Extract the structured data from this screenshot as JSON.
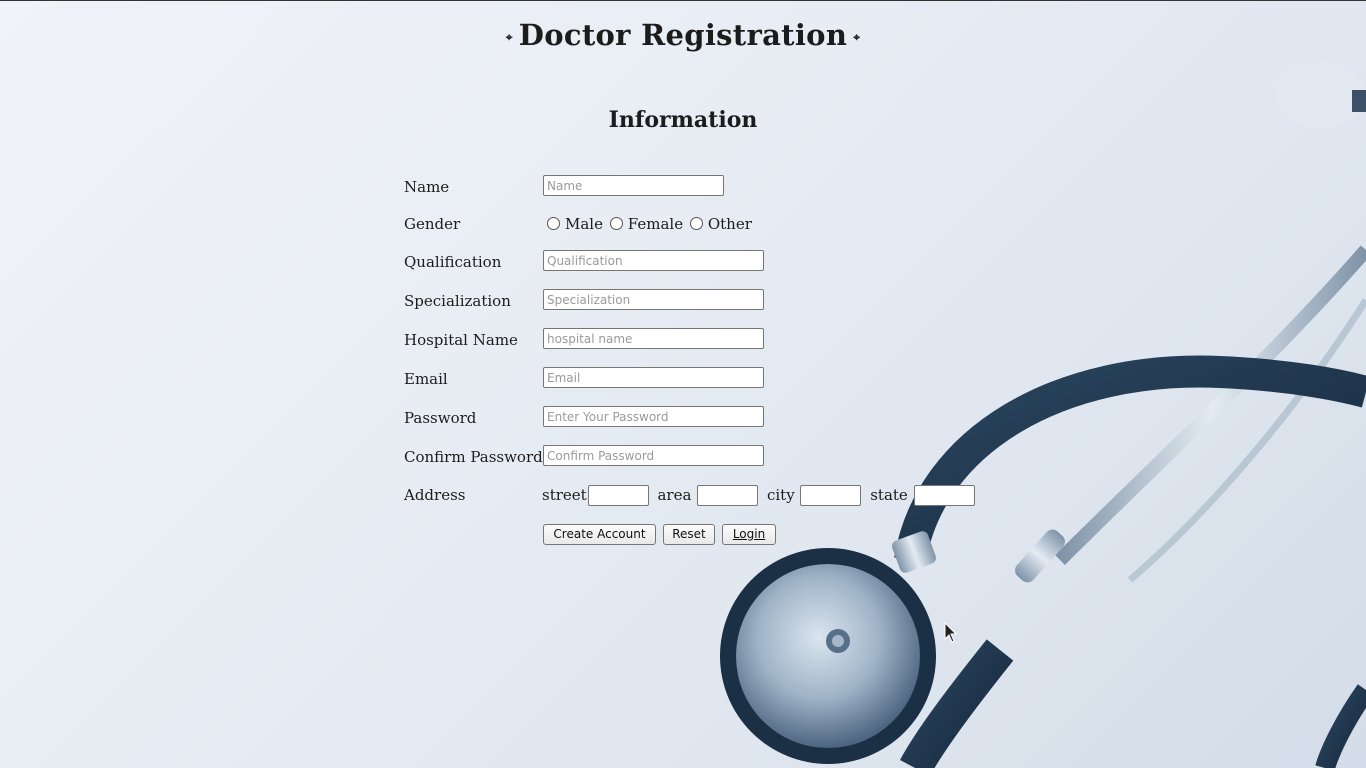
{
  "page": {
    "title": "Doctor Registration",
    "title_decoration": "⌖",
    "section_title": "Information"
  },
  "form": {
    "name": {
      "label": "Name",
      "placeholder": "Name",
      "value": ""
    },
    "gender": {
      "label": "Gender",
      "options": [
        "Male",
        "Female",
        "Other"
      ],
      "selected": ""
    },
    "qualification": {
      "label": "Qualification",
      "placeholder": "Qualification",
      "value": ""
    },
    "specialization": {
      "label": "Specialization",
      "placeholder": "Specialization",
      "value": ""
    },
    "hospital_name": {
      "label": "Hospital Name",
      "placeholder": "hospital name",
      "value": ""
    },
    "email": {
      "label": "Email",
      "placeholder": "Email",
      "value": ""
    },
    "password": {
      "label": "Password",
      "placeholder": "Enter Your Password",
      "value": ""
    },
    "confirm_password": {
      "label": "Confirm Password",
      "placeholder": "Confirm Password",
      "value": ""
    },
    "address": {
      "label": "Address",
      "street_label": "street",
      "area_label": "area",
      "city_label": "city",
      "state_label": "state"
    }
  },
  "buttons": {
    "create_account": "Create Account",
    "reset": "Reset",
    "login": "Login"
  },
  "colors": {
    "background": "#e8edf4",
    "stethoscope_tube": "#1f3448",
    "stethoscope_metal": "#a9b8c7"
  },
  "icons": {
    "background_image": "stethoscope",
    "cursor": "mouse-pointer-icon"
  }
}
